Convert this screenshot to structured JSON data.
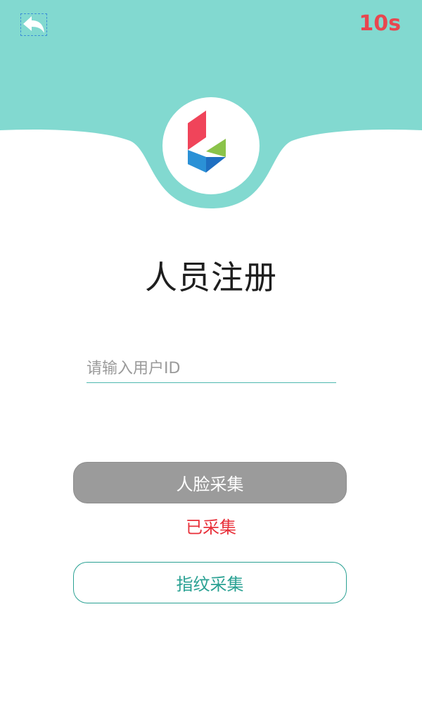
{
  "header": {
    "back_icon": "back-arrow-icon",
    "countdown": "10s",
    "accent_color": "#82d9d0",
    "countdown_color": "#e8464f"
  },
  "logo": {
    "icon": "app-logo-icon",
    "colors": [
      "#f0445a",
      "#8bc34a",
      "#1f6fc1",
      "#2b91d6"
    ]
  },
  "page": {
    "title": "人员注册"
  },
  "form": {
    "user_id": {
      "value": "",
      "placeholder": "请输入用户ID"
    }
  },
  "actions": {
    "face_capture_label": "人脸采集",
    "face_status": "已采集",
    "fingerprint_capture_label": "指纹采集"
  }
}
